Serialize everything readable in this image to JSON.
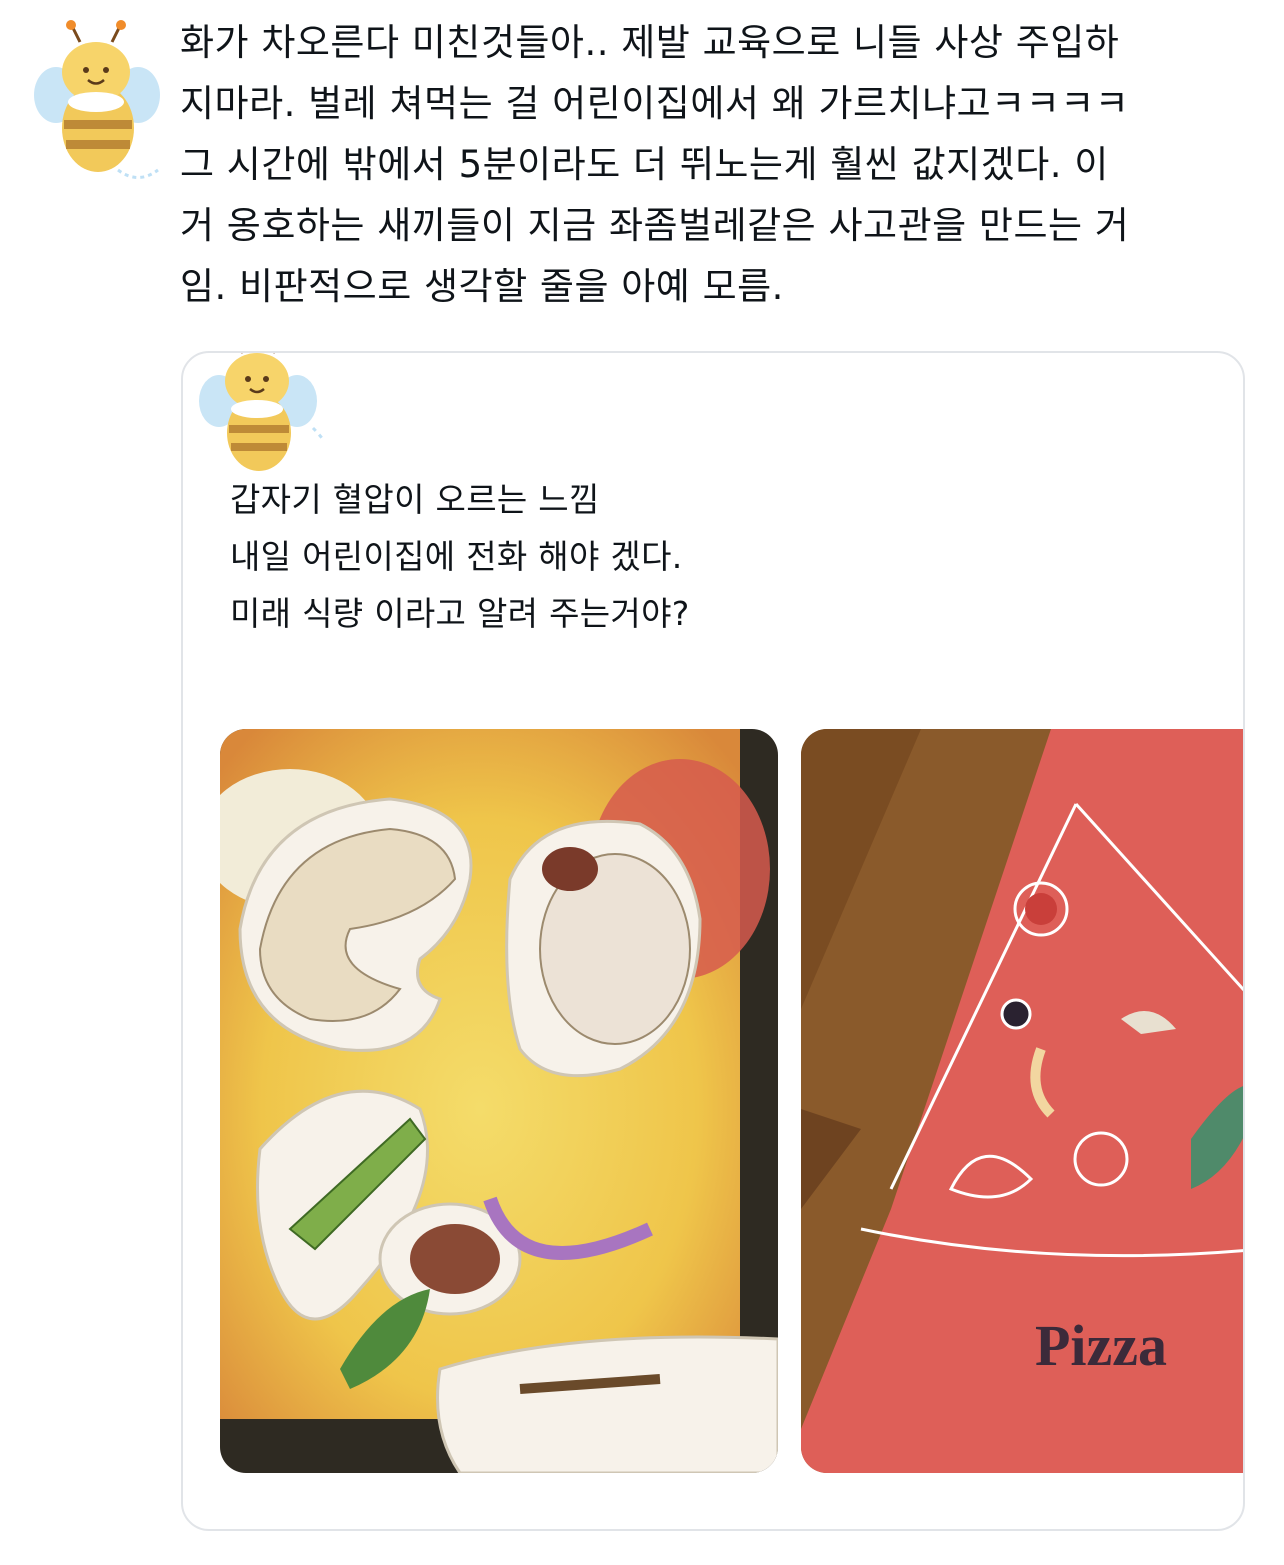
{
  "tweet": {
    "text": "화가 차오른다 미친것들아.. 제발 교육으로 니들 사상 주입하\n지마라. 벌레 쳐먹는 걸 어린이집에서 왜 가르치냐고ㅋㅋㅋㅋ\n그 시간에 밖에서 5분이라도 더 뛰노는게 훨씬 값지겠다. 이\n거 옹호하는 새끼들이 지금 좌좀벌레같은 사고관을 만드는 거\n임. 비판적으로 생각할 줄을 아예 모름."
  },
  "quoted": {
    "lines": [
      "갑자기 혈압이 오르는 느낌",
      "내일 어린이집에 전화 해야 겠다.",
      "미래 식량 이라고 알려 주는거야?"
    ],
    "images": [
      {
        "icon": "insect-cards-photo"
      },
      {
        "icon": "pizza-slice-photo",
        "label": "Pizza"
      }
    ]
  },
  "colors": {
    "text": "#0f1419",
    "card_border": "#e1e4e8",
    "pizza_red": "#de5f58",
    "pizza_label": "#3b2a3a",
    "wood": "#8a5a2b",
    "tray_yellow": "#efc94a"
  }
}
